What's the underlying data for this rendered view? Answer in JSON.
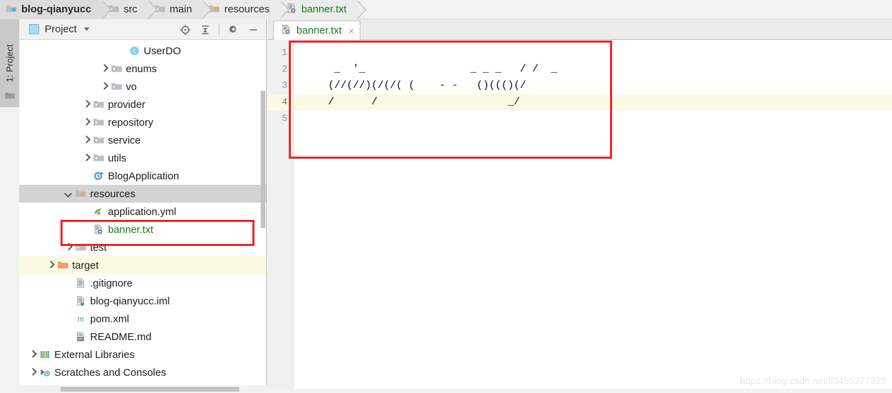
{
  "breadcrumb": {
    "items": [
      {
        "label": "blog-qianyucc",
        "icon": "module-folder-icon",
        "bold": true,
        "style": "crumb"
      },
      {
        "label": "src",
        "icon": "folder-icon",
        "bold": false,
        "style": "lighter"
      },
      {
        "label": "main",
        "icon": "folder-icon",
        "bold": false,
        "style": "lighter"
      },
      {
        "label": "resources",
        "icon": "resources-folder-icon",
        "bold": false,
        "style": "lightest"
      },
      {
        "label": "banner.txt",
        "icon": "txt-file-icon",
        "bold": false,
        "style": "lightest",
        "green": true
      }
    ]
  },
  "left_strip": {
    "label": "1: Project"
  },
  "panel": {
    "title": "Project",
    "tools": [
      {
        "name": "locate-icon",
        "tooltip": "Select Opened File"
      },
      {
        "name": "collapse-all-icon",
        "tooltip": "Collapse All"
      },
      {
        "name": "gear-icon",
        "tooltip": "Settings"
      },
      {
        "name": "minimize-icon",
        "tooltip": "Hide"
      }
    ]
  },
  "tree": {
    "items": [
      {
        "label": "UserDO",
        "indent": 5,
        "arrow": "none",
        "icon": "java-class-icon",
        "state": "none"
      },
      {
        "label": "enums",
        "indent": 4,
        "arrow": "right",
        "icon": "folder-icon",
        "state": "none"
      },
      {
        "label": "vo",
        "indent": 4,
        "arrow": "right",
        "icon": "folder-icon",
        "state": "none"
      },
      {
        "label": "provider",
        "indent": 3,
        "arrow": "right",
        "icon": "folder-icon",
        "state": "none"
      },
      {
        "label": "repository",
        "indent": 3,
        "arrow": "right",
        "icon": "folder-icon",
        "state": "none"
      },
      {
        "label": "service",
        "indent": 3,
        "arrow": "right",
        "icon": "folder-icon",
        "state": "none"
      },
      {
        "label": "utils",
        "indent": 3,
        "arrow": "right",
        "icon": "folder-icon",
        "state": "none"
      },
      {
        "label": "BlogApplication",
        "indent": 3,
        "arrow": "none",
        "icon": "spring-boot-icon",
        "state": "none"
      },
      {
        "label": "resources",
        "indent": 2,
        "arrow": "down",
        "icon": "resources-folder-icon",
        "state": "selected"
      },
      {
        "label": "application.yml",
        "indent": 3,
        "arrow": "none",
        "icon": "yaml-spring-icon",
        "state": "none"
      },
      {
        "label": "banner.txt",
        "indent": 3,
        "arrow": "none",
        "icon": "txt-file-icon",
        "state": "none",
        "green": true
      },
      {
        "label": "test",
        "indent": 2,
        "arrow": "right",
        "icon": "folder-icon",
        "state": "none"
      },
      {
        "label": "target",
        "indent": 1,
        "arrow": "right",
        "icon": "target-folder-icon",
        "state": "highlight"
      },
      {
        "label": ".gitignore",
        "indent": 2,
        "arrow": "none",
        "icon": "text-file-icon",
        "state": "none"
      },
      {
        "label": "blog-qianyucc.iml",
        "indent": 2,
        "arrow": "none",
        "icon": "iml-file-icon",
        "state": "none"
      },
      {
        "label": "pom.xml",
        "indent": 2,
        "arrow": "none",
        "icon": "maven-icon",
        "state": "none"
      },
      {
        "label": "README.md",
        "indent": 2,
        "arrow": "none",
        "icon": "markdown-icon",
        "state": "none"
      },
      {
        "label": "External Libraries",
        "indent": 0,
        "arrow": "right",
        "icon": "libraries-icon",
        "state": "none"
      },
      {
        "label": "Scratches and Consoles",
        "indent": 0,
        "arrow": "right",
        "icon": "scratches-icon",
        "state": "none"
      }
    ]
  },
  "editor": {
    "tab": {
      "label": "banner.txt",
      "icon": "txt-file-icon",
      "close_label": "×"
    },
    "line_numbers": [
      "1",
      "2",
      "3",
      "4",
      "5"
    ],
    "current_line": 4,
    "lines": [
      "",
      "   _  '_                 _ _ _   / /  _",
      "  (//(//)(/(/( (    - -   ()((()(/",
      "  /      /                     _/",
      ""
    ]
  },
  "watermark": {
    "text": "https://blog.csdn.net/li3455277925"
  },
  "colors": {
    "accent_green": "#1a7a1a",
    "annotation_red": "#ef2323",
    "selection_gray": "#d4d4d4",
    "highlight_cream": "#fdfae4",
    "panel_bg": "#f2f2f2"
  }
}
